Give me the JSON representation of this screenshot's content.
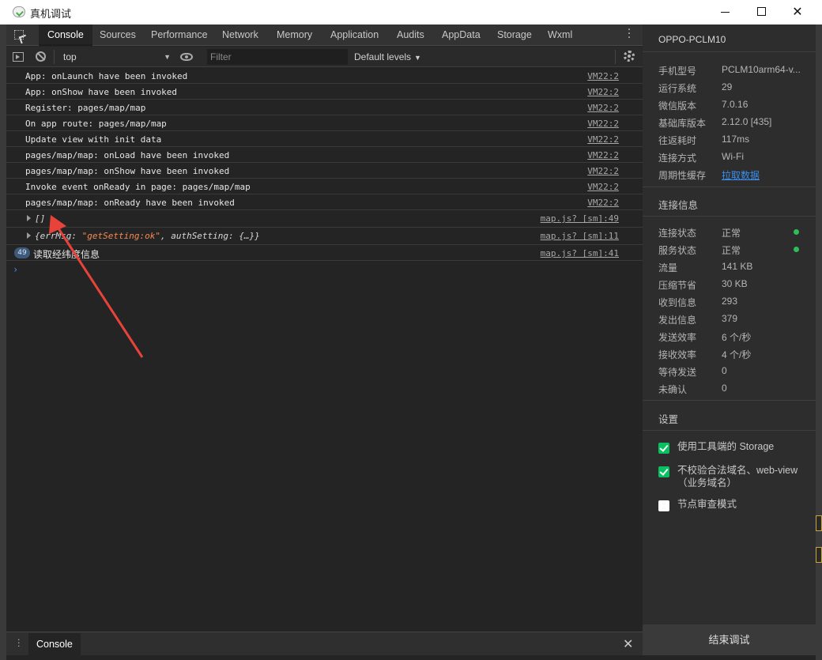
{
  "window": {
    "title": "真机调试",
    "minimize_label": "",
    "maximize_label": "",
    "close_label": "✕"
  },
  "tabs": [
    {
      "label": "Console",
      "active": true
    },
    {
      "label": "Sources"
    },
    {
      "label": "Performance"
    },
    {
      "label": "Network"
    },
    {
      "label": "Memory"
    },
    {
      "label": "Application"
    },
    {
      "label": "Audits"
    },
    {
      "label": "AppData"
    },
    {
      "label": "Storage"
    },
    {
      "label": "Wxml"
    }
  ],
  "toolbar": {
    "context": "top",
    "filter_placeholder": "Filter",
    "levels": "Default levels"
  },
  "console": {
    "messages": [
      {
        "text": "App: onLaunch have been invoked",
        "source": "VM22:2"
      },
      {
        "text": "App: onShow have been invoked",
        "source": "VM22:2"
      },
      {
        "text": "Register: pages/map/map",
        "source": "VM22:2"
      },
      {
        "text": "On app route: pages/map/map",
        "source": "VM22:2"
      },
      {
        "text": "Update view with init data",
        "source": "VM22:2"
      },
      {
        "text": "pages/map/map: onLoad have been invoked",
        "source": "VM22:2"
      },
      {
        "text": "pages/map/map: onShow have been invoked",
        "source": "VM22:2"
      },
      {
        "text": "Invoke event onReady in page: pages/map/map",
        "source": "VM22:2"
      },
      {
        "text": "pages/map/map: onReady have been invoked",
        "source": "VM22:2"
      }
    ],
    "array_message": {
      "text": "[]",
      "source": "map.js? [sm]:49"
    },
    "object_message": {
      "prefix": "{errMsg: ",
      "string": "\"getSetting:ok\"",
      "suffix": ", authSetting: {…}}",
      "source": "map.js? [sm]:11"
    },
    "grouped_message": {
      "count": "49",
      "text": "读取经纬度信息",
      "source": "map.js? [sm]:41"
    },
    "prompt": "›"
  },
  "drawer": {
    "tab": "Console",
    "close": "✕"
  },
  "panel": {
    "device": "OPPO-PCLM10",
    "info": [
      {
        "k": "手机型号",
        "v": "PCLM10arm64-v..."
      },
      {
        "k": "运行系统",
        "v": "29"
      },
      {
        "k": "微信版本",
        "v": "7.0.16"
      },
      {
        "k": "基础库版本",
        "v": "2.12.0 [435]"
      },
      {
        "k": "往返耗时",
        "v": "117ms"
      },
      {
        "k": "连接方式",
        "v": "Wi-Fi"
      },
      {
        "k": "周期性缓存",
        "v": "拉取数据"
      }
    ],
    "conn_title": "连接信息",
    "conn": [
      {
        "k": "连接状态",
        "v": "正常"
      },
      {
        "k": "服务状态",
        "v": "正常"
      },
      {
        "k": "流量",
        "v": "141 KB"
      },
      {
        "k": "压缩节省",
        "v": "30 KB"
      },
      {
        "k": "收到信息",
        "v": "293"
      },
      {
        "k": "发出信息",
        "v": "379"
      },
      {
        "k": "发送效率",
        "v": "6 个/秒"
      },
      {
        "k": "接收效率",
        "v": "4 个/秒"
      },
      {
        "k": "等待发送",
        "v": "0"
      },
      {
        "k": "未确认",
        "v": "0"
      }
    ],
    "settings_title": "设置",
    "settings": [
      {
        "label": "使用工具端的 Storage",
        "checked": true
      },
      {
        "label": "不校验合法域名、web-view（业务域名）",
        "checked": true
      },
      {
        "label": "节点审查模式",
        "checked": false
      }
    ],
    "end_button": "结束调试"
  },
  "colors": {
    "accent_blue": "#3b8ef0",
    "status_green": "#2fbd5b",
    "checkbox_green": "#07c160",
    "annotation_arrow": "#e8433b"
  }
}
